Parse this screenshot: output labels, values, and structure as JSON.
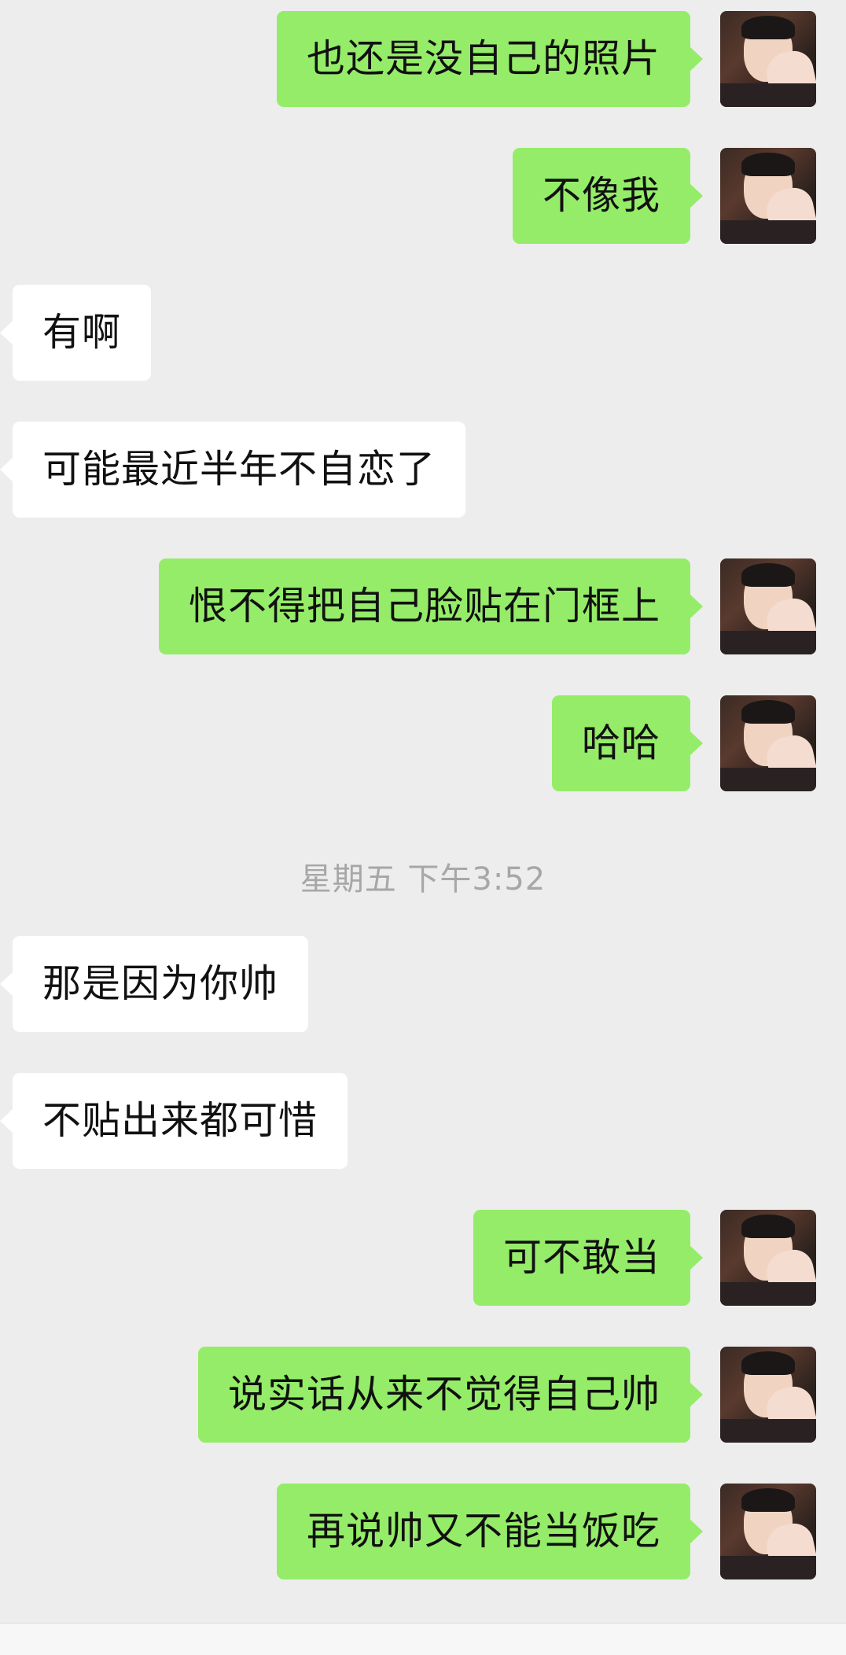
{
  "messages": [
    {
      "side": "sent",
      "text": "也还是没自己的照片"
    },
    {
      "side": "sent",
      "text": "不像我"
    },
    {
      "side": "recv",
      "text": "有啊"
    },
    {
      "side": "recv",
      "text": "可能最近半年不自恋了"
    },
    {
      "side": "sent",
      "text": "恨不得把自己脸贴在门框上"
    },
    {
      "side": "sent",
      "text": "哈哈"
    },
    {
      "side": "recv",
      "text": "那是因为你帅"
    },
    {
      "side": "recv",
      "text": "不贴出来都可惜"
    },
    {
      "side": "sent",
      "text": "可不敢当"
    },
    {
      "side": "sent",
      "text": "说实话从来不觉得自己帅"
    },
    {
      "side": "sent",
      "text": "再说帅又不能当饭吃"
    }
  ],
  "timestamp": "星期五 下午3:52",
  "colors": {
    "background": "#ededed",
    "sent_bubble": "#95ec69",
    "received_bubble": "#ffffff",
    "timestamp_text": "#a7a7a7"
  },
  "icons": {
    "avatar": "user-avatar-photo"
  }
}
